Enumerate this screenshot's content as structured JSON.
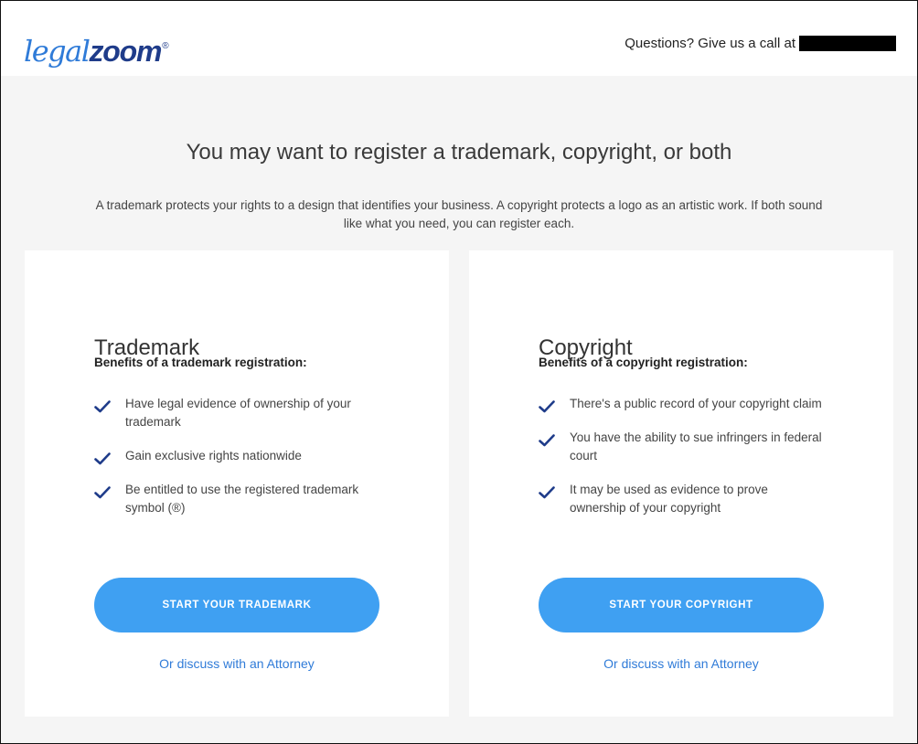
{
  "header": {
    "logo_part1": "legal",
    "logo_part2": "zoom",
    "logo_reg": "®",
    "contact_text": "Questions? Give us a call at"
  },
  "main": {
    "title": "You may want to register a trademark, copyright, or both",
    "intro": "A trademark protects your rights to a design that identifies your business. A copyright protects a logo as an artistic work. If both sound like what you need, you can register each."
  },
  "cards": [
    {
      "title": "Trademark",
      "subtitle": "Benefits of a trademark registration:",
      "benefits": [
        "Have legal evidence of ownership of your trademark",
        "Gain exclusive rights nationwide",
        "Be entitled to use the registered trademark symbol (®)"
      ],
      "button_label": "START YOUR TRADEMARK",
      "link_label": "Or discuss with an Attorney"
    },
    {
      "title": "Copyright",
      "subtitle": "Benefits of a copyright registration:",
      "benefits": [
        "There's a public record of your copyright claim",
        "You have the ability to sue infringers in federal court",
        "It may be used as evidence to prove ownership of your copyright"
      ],
      "button_label": "START YOUR COPYRIGHT",
      "link_label": "Or discuss with an Attorney"
    }
  ],
  "colors": {
    "accent_button": "#3fa0f2",
    "link": "#2f7bd8",
    "logo_dark": "#1f3c8a",
    "check": "#1f3c8a"
  },
  "icons": {
    "benefit_bullet": "checkmark-icon"
  }
}
